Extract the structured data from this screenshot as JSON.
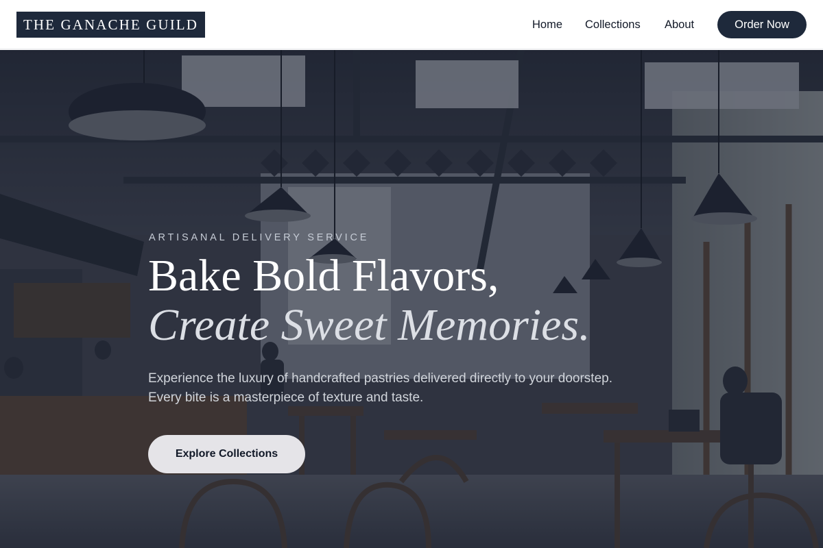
{
  "brand": {
    "name": "THE GANACHE GUILD"
  },
  "nav": {
    "links": [
      "Home",
      "Collections",
      "About"
    ],
    "cta_label": "Order Now"
  },
  "hero": {
    "eyebrow": "ARTISANAL DELIVERY SERVICE",
    "headline_line1": "Bake Bold Flavors,",
    "headline_line2": "Create Sweet Memories.",
    "subtext": "Experience the luxury of handcrafted pastries delivered directly to your doorstep. Every bite is a masterpiece of texture and taste.",
    "cta_label": "Explore Collections",
    "background_image": "dimmed cafe interior with pendant lamps, wooden tables and chairs, counter with barista, customer with laptop"
  },
  "colors": {
    "brand_navy": "#1e293b",
    "nav_text": "#111827",
    "hero_overlay": "#1c2333",
    "cta_background": "#e5e4e8"
  }
}
